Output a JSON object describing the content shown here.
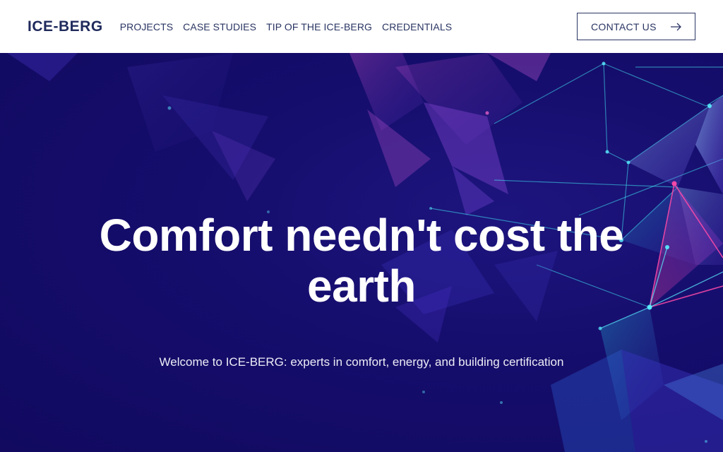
{
  "header": {
    "logo": "ICE-BERG",
    "nav": [
      {
        "label": "PROJECTS"
      },
      {
        "label": "CASE STUDIES"
      },
      {
        "label": "TIP OF THE ICE-BERG"
      },
      {
        "label": "CREDENTIALS"
      }
    ],
    "contact_label": "CONTACT US",
    "contact_icon": "arrow-right-icon"
  },
  "hero": {
    "headline_line1": "Comfort needn't cost the",
    "headline_line2": "earth",
    "subtitle": "Welcome to ICE-BERG: experts in comfort, energy, and building certification",
    "background": "abstract-network-polygons"
  },
  "colors": {
    "brand_navy": "#1f2a5c",
    "hero_background": "#150d6b",
    "header_background": "#ffffff",
    "accent_cyan": "#3fe0f0",
    "accent_magenta": "#f0409a"
  }
}
